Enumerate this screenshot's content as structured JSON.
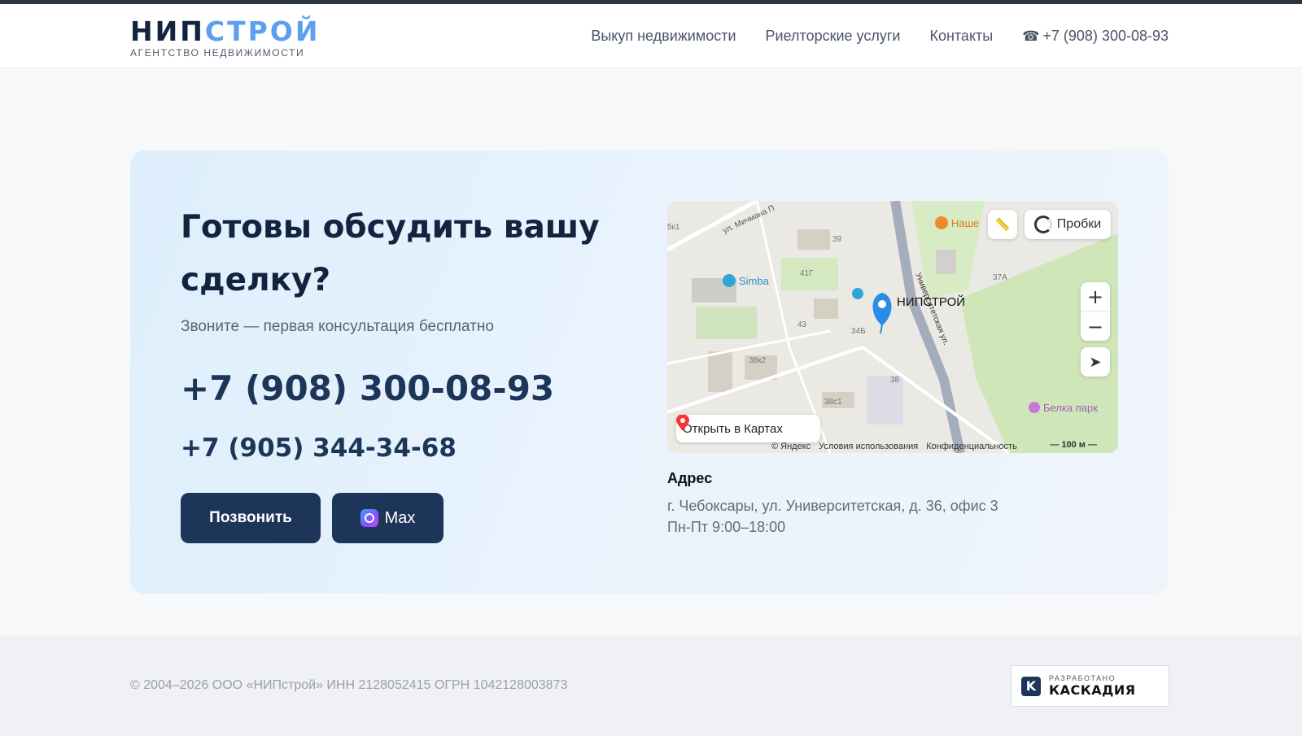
{
  "header": {
    "logo_part1": "НИП",
    "logo_part2": "СТРОЙ",
    "logo_subtitle": "АГЕНТСТВО НЕДВИЖИМОСТИ",
    "nav": [
      "Выкуп недвижимости",
      "Риелторские услуги",
      "Контакты"
    ],
    "phone": "+7 (908) 300-08-93"
  },
  "contact": {
    "title": "Готовы обсудить вашу сделку?",
    "subtitle": "Звоните — первая консультация бесплатно",
    "phone_main": "+7 (908) 300-08-93",
    "phone_secondary": "+7 (905) 344-34-68",
    "call_button": "Позвонить",
    "max_button": "Max"
  },
  "map": {
    "traffic_label": "Пробки",
    "open_maps_label": "Открыть в Картах",
    "marker_label": "НИПСТРОЙ",
    "poi": [
      "Simba",
      "Наше",
      "Белка парк"
    ],
    "street_labels": [
      "ул. Мичмана П",
      "Университетская ул."
    ],
    "building_numbers": [
      "39",
      "41Г",
      "43",
      "34Б",
      "38к2",
      "38",
      "38с1",
      "37А",
      "5к1"
    ],
    "footer": [
      "© Яндекс",
      "Условия использования",
      "Конфиденциальность"
    ],
    "scale": "100 м"
  },
  "address": {
    "label": "Адрес",
    "line1": "г. Чебоксары, ул. Университетская, д. 36, офис 3",
    "line2": "Пн-Пт 9:00–18:00"
  },
  "footer": {
    "copyright": "© 2004–2026 ООО «НИПстрой» ИНН 2128052415 ОГРН 1042128003873",
    "dev_label": "РАЗРАБОТАНО",
    "dev_name": "КАСКАДИЯ"
  },
  "colors": {
    "brand_dark": "#13233f",
    "brand_blue": "#5d9ef0",
    "button": "#1d3558",
    "card_bg": "#e3f0fc"
  }
}
